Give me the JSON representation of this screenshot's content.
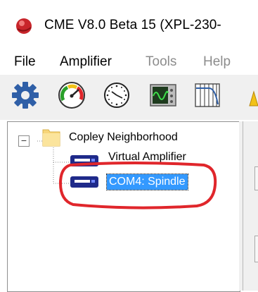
{
  "window": {
    "title": "CME V8.0 Beta 15 (XPL-230-"
  },
  "menu": {
    "items": [
      {
        "label": "File",
        "enabled": true
      },
      {
        "label": "Amplifier",
        "enabled": true
      },
      {
        "label": "Tools",
        "enabled": false
      },
      {
        "label": "Help",
        "enabled": false
      }
    ]
  },
  "toolbar": {
    "buttons": [
      {
        "icon": "gear-icon"
      },
      {
        "icon": "gauge-icon"
      },
      {
        "icon": "clock-icon"
      },
      {
        "icon": "oscilloscope-icon"
      },
      {
        "icon": "filter-plot-icon"
      }
    ]
  },
  "tree": {
    "root": {
      "label": "Copley Neighborhood",
      "expander": "−",
      "icon": "folder-icon"
    },
    "children": [
      {
        "label": "Virtual Amplifier",
        "icon": "amplifier-icon",
        "selected": false
      },
      {
        "label": "COM4: Spindle",
        "icon": "amplifier-icon",
        "selected": true
      }
    ]
  },
  "colors": {
    "selection": "#3399ff",
    "annotation": "#e0262b",
    "gear": "#2f5fa7",
    "amplifier": "#1f2a8a"
  }
}
